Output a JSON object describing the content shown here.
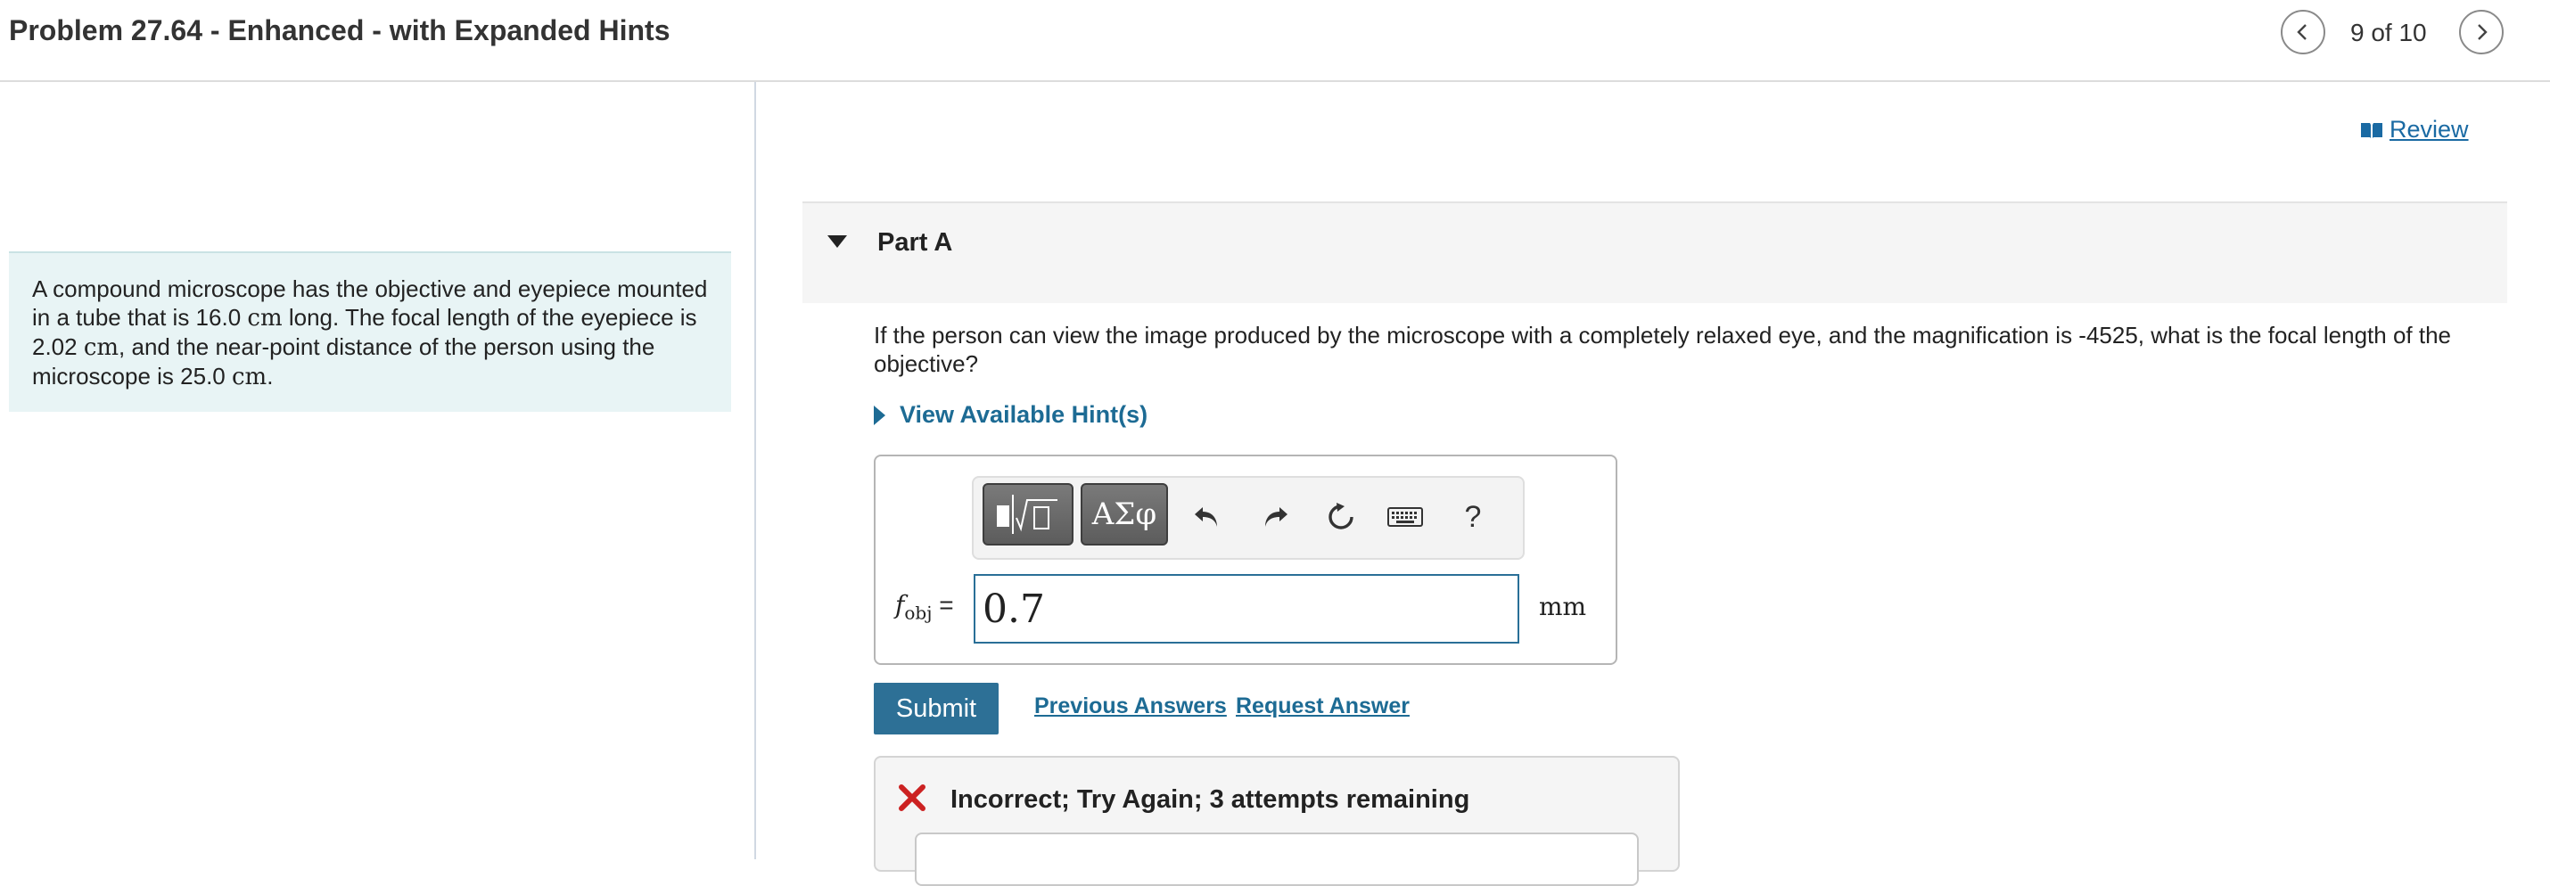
{
  "header": {
    "title": "Problem 27.64 - Enhanced - with Expanded Hints",
    "page_count": "9 of 10"
  },
  "context": {
    "text_1": "A compound microscope has the objective and eyepiece mounted in a tube that is 16.0 ",
    "unit_1": "cm",
    "text_2": " long. The focal length of the eyepiece is 2.02 ",
    "unit_2": "cm",
    "text_3": ", and the near-point distance of the person using the microscope is 25.0 ",
    "unit_3": "cm",
    "text_4": "."
  },
  "review": {
    "label": " Review"
  },
  "part": {
    "title": "Part A",
    "question": "If the person can view the image produced by the microscope with a completely relaxed eye, and the magnification is -4525, what is the focal length of the objective?",
    "hint_label": "View Available Hint(s)"
  },
  "toolbar": {
    "symbols_label": "ΑΣφ",
    "help_label": "?"
  },
  "answer": {
    "var_symbol": "f",
    "var_subscript": "obj",
    "equals": " =",
    "value": "0.7",
    "unit": "mm"
  },
  "actions": {
    "submit_label": "Submit",
    "previous_answers": "Previous Answers",
    "request_answer": "Request Answer"
  },
  "feedback": {
    "message": "Incorrect; Try Again; 3 attempts remaining"
  },
  "colors": {
    "accent": "#1d6b94",
    "submit": "#2d7096",
    "error": "#cc2222",
    "context_bg": "#e8f4f5"
  }
}
